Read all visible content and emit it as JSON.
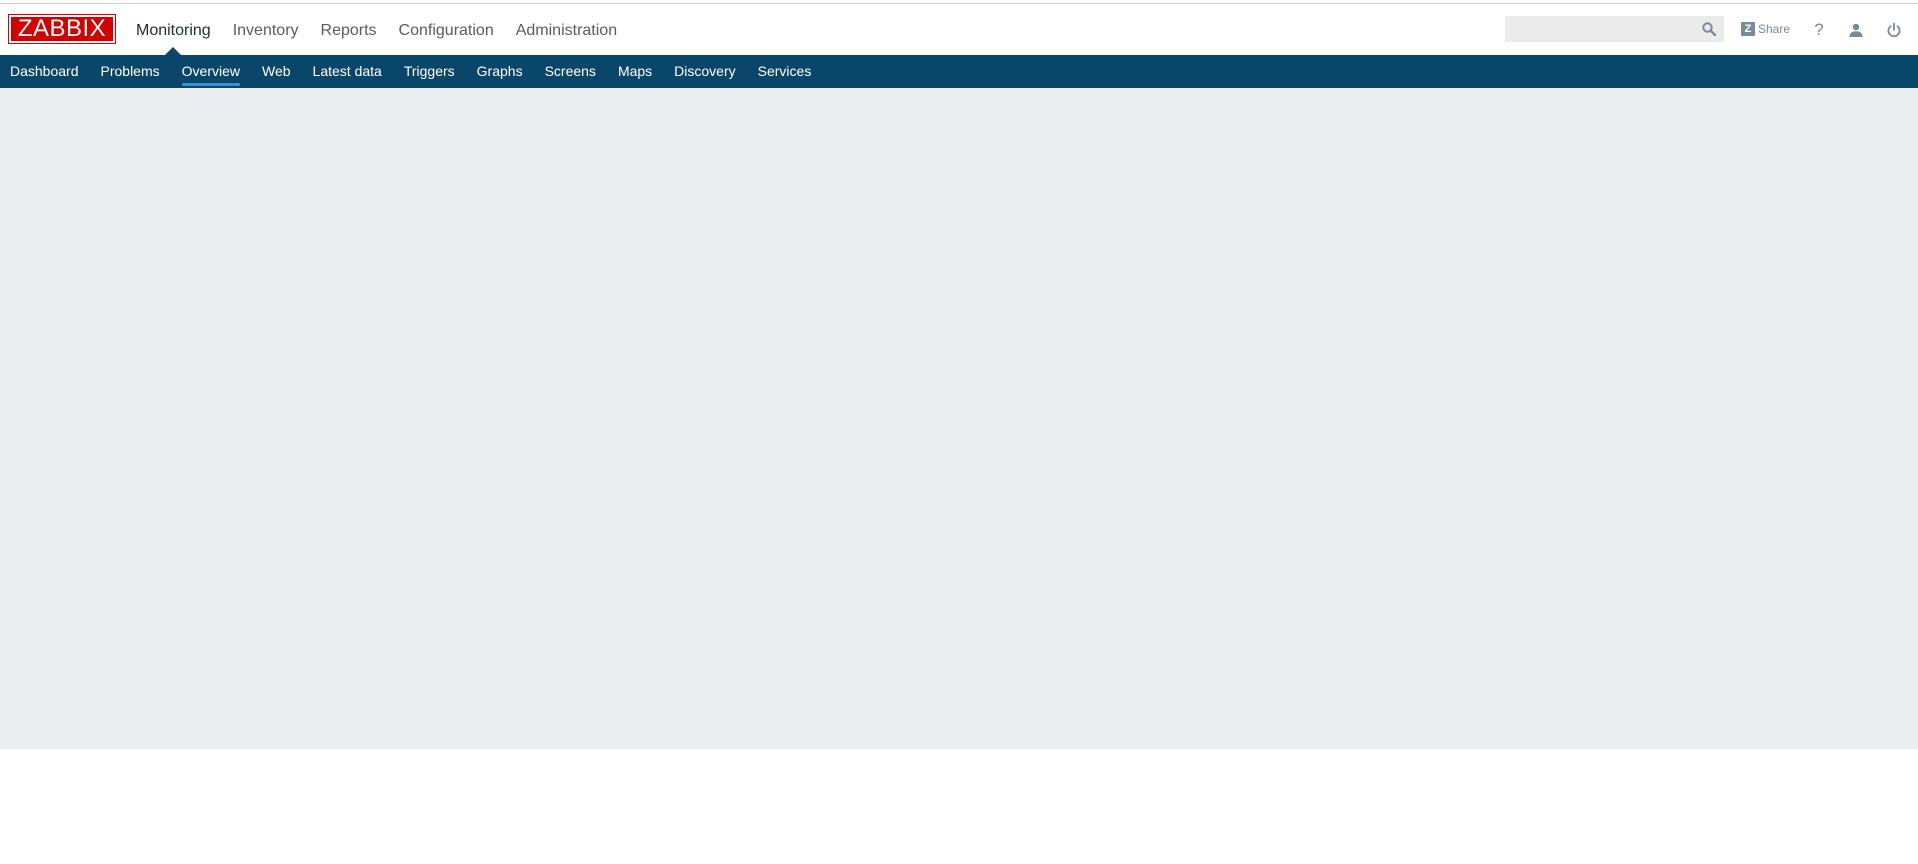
{
  "logo": {
    "text": "ZABBIX"
  },
  "main_menu": [
    {
      "label": "Monitoring",
      "selected": true
    },
    {
      "label": "Inventory",
      "selected": false
    },
    {
      "label": "Reports",
      "selected": false
    },
    {
      "label": "Configuration",
      "selected": false
    },
    {
      "label": "Administration",
      "selected": false
    }
  ],
  "sub_menu": [
    {
      "label": "Dashboard",
      "selected": false
    },
    {
      "label": "Problems",
      "selected": false
    },
    {
      "label": "Overview",
      "selected": true
    },
    {
      "label": "Web",
      "selected": false
    },
    {
      "label": "Latest data",
      "selected": false
    },
    {
      "label": "Triggers",
      "selected": false
    },
    {
      "label": "Graphs",
      "selected": false
    },
    {
      "label": "Screens",
      "selected": false
    },
    {
      "label": "Maps",
      "selected": false
    },
    {
      "label": "Discovery",
      "selected": false
    },
    {
      "label": "Services",
      "selected": false
    }
  ],
  "search": {
    "value": "",
    "placeholder": ""
  },
  "header_links": {
    "share_label": "Share",
    "help_label": "?"
  },
  "icons": {
    "search": "search-icon",
    "share": "zabbix-share-icon",
    "help": "help-icon",
    "user": "user-profile-icon",
    "logout": "power-icon"
  },
  "colors": {
    "brand_red": "#d40000",
    "nav_blue": "#0a466a",
    "selected_underline": "#3f8dcc",
    "content_bg": "#ebeef0"
  }
}
